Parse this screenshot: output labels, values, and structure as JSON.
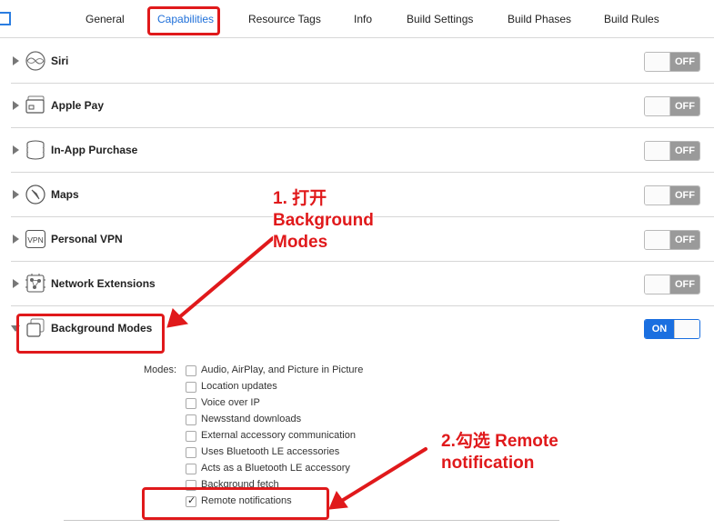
{
  "tabs": [
    {
      "label": "General"
    },
    {
      "label": "Capabilities"
    },
    {
      "label": "Resource Tags"
    },
    {
      "label": "Info"
    },
    {
      "label": "Build Settings"
    },
    {
      "label": "Build Phases"
    },
    {
      "label": "Build Rules"
    }
  ],
  "active_tab": "Capabilities",
  "capabilities": [
    {
      "title": "Siri",
      "icon": "siri-icon",
      "state": "OFF"
    },
    {
      "title": "Apple Pay",
      "icon": "apple-pay-icon",
      "state": "OFF"
    },
    {
      "title": "In-App Purchase",
      "icon": "in-app-purchase-icon",
      "state": "OFF"
    },
    {
      "title": "Maps",
      "icon": "maps-icon",
      "state": "OFF"
    },
    {
      "title": "Personal VPN",
      "icon": "personal-vpn-icon",
      "state": "OFF"
    },
    {
      "title": "Network Extensions",
      "icon": "network-extensions-icon",
      "state": "OFF"
    },
    {
      "title": "Background Modes",
      "icon": "background-modes-icon",
      "state": "ON"
    }
  ],
  "vpn_icon_text": "VPN",
  "background_modes": {
    "label": "Modes:",
    "items": [
      {
        "label": "Audio, AirPlay, and Picture in Picture",
        "checked": false
      },
      {
        "label": "Location updates",
        "checked": false
      },
      {
        "label": "Voice over IP",
        "checked": false
      },
      {
        "label": "Newsstand downloads",
        "checked": false
      },
      {
        "label": "External accessory communication",
        "checked": false
      },
      {
        "label": "Uses Bluetooth LE accessories",
        "checked": false
      },
      {
        "label": "Acts as a Bluetooth LE accessory",
        "checked": false
      },
      {
        "label": "Background fetch",
        "checked": false
      },
      {
        "label": "Remote notifications",
        "checked": true
      }
    ]
  },
  "annotations": {
    "step1": [
      "1. 打开",
      "Background",
      "Modes"
    ],
    "step2": [
      "2.勾选 Remote",
      "notification"
    ]
  },
  "colors": {
    "accent": "#1e6fd9",
    "annotation_red": "#e0191b",
    "switch_off": "#9a9a9a",
    "switch_on": "#1a6fe0"
  }
}
